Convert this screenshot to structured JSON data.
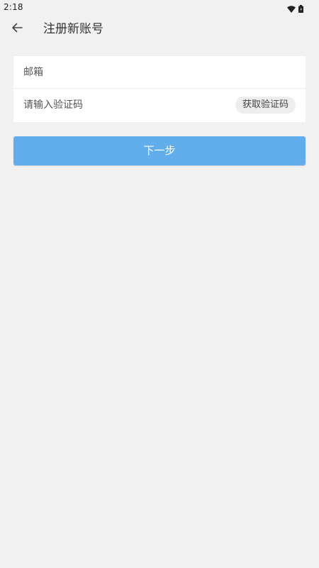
{
  "status_bar": {
    "time": "2:18",
    "icons": [
      "wifi-icon",
      "battery-icon"
    ]
  },
  "header": {
    "back_icon": "arrow-left-icon",
    "title": "注册新账号"
  },
  "form": {
    "email_placeholder": "邮箱",
    "email_value": "",
    "code_placeholder": "请输入验证码",
    "code_value": "",
    "get_code_label": "获取验证码"
  },
  "actions": {
    "next_label": "下一步"
  },
  "colors": {
    "background": "#f1f1f1",
    "primary_button": "#62aeec",
    "code_button_bg": "#eeeeee"
  }
}
